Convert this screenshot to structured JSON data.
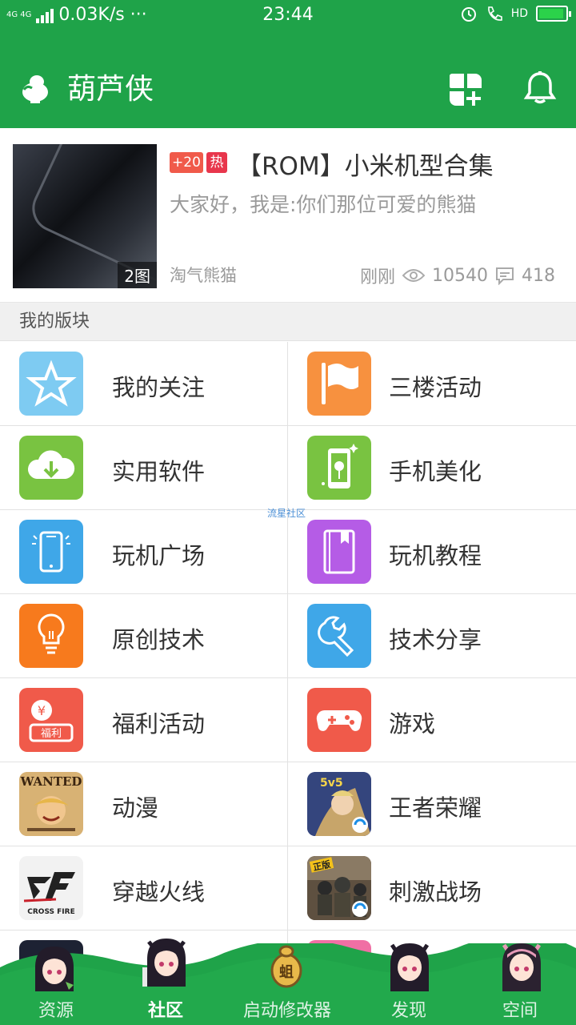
{
  "status_bar": {
    "network": "4G 4G",
    "speed": "0.03K/s ···",
    "time": "23:44",
    "hd": "HD",
    "color": "#1fa349"
  },
  "app_bar": {
    "title": "葫芦侠",
    "icons": [
      "gourd-logo-icon",
      "apps-add-icon",
      "bell-icon"
    ]
  },
  "featured_post": {
    "image_count": "2图",
    "tag_plus": "+20",
    "tag_hot": "热",
    "title": "【ROM】小米机型合集",
    "subtitle": "大家好，我是:你们那位可爱的熊猫",
    "author": "淘气熊猫",
    "time": "刚刚",
    "views": "10540",
    "comments": "418"
  },
  "section": {
    "title": "我的版块"
  },
  "boards": [
    {
      "label": "我的关注",
      "icon": "star-icon",
      "color": "#7ecbf2"
    },
    {
      "label": "三楼活动",
      "icon": "flag-icon",
      "color": "#f7913f"
    },
    {
      "label": "实用软件",
      "icon": "cloud-download-icon",
      "color": "#79c341"
    },
    {
      "label": "手机美化",
      "icon": "phone-flower-icon",
      "color": "#79c341"
    },
    {
      "label": "玩机广场",
      "icon": "phone-icon",
      "color": "#3fa7e8"
    },
    {
      "label": "玩机教程",
      "icon": "book-icon",
      "color": "#b55ce6"
    },
    {
      "label": "原创技术",
      "icon": "lightbulb-icon",
      "color": "#f77a1d"
    },
    {
      "label": "技术分享",
      "icon": "wrench-icon",
      "color": "#3fa7e8"
    },
    {
      "label": "福利活动",
      "icon": "welfare-icon",
      "color": "#f05a4a",
      "badge": "福利"
    },
    {
      "label": "游戏",
      "icon": "gamepad-icon",
      "color": "#f05a4a"
    },
    {
      "label": "动漫",
      "icon": "anime-wanted-icon",
      "color": "#c89a52",
      "badge": "WANTED"
    },
    {
      "label": "王者荣耀",
      "icon": "honor-of-kings-icon",
      "color": "#3a4d8c",
      "badge": "5v5"
    },
    {
      "label": "穿越火线",
      "icon": "crossfire-icon",
      "color": "#e9e9e9",
      "badge": "CROSS FIRE"
    },
    {
      "label": "刺激战场",
      "icon": "pubg-icon",
      "color": "#6b5a45",
      "badge": "正版"
    }
  ],
  "watermark": "流星社区",
  "bottom_nav": [
    {
      "label": "资源",
      "active": false
    },
    {
      "label": "社区",
      "active": true
    },
    {
      "label": "启动修改器",
      "active": false,
      "badge": "蛆"
    },
    {
      "label": "发现",
      "active": false
    },
    {
      "label": "空间",
      "active": false
    }
  ]
}
